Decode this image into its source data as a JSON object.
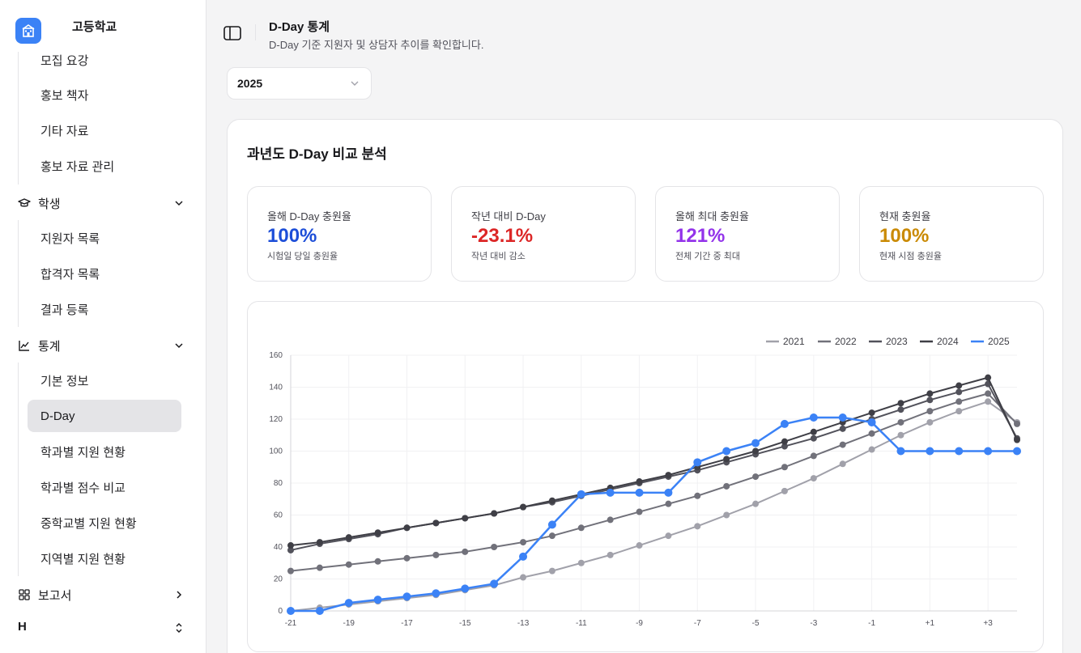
{
  "sidebar": {
    "school_name": "고등학교",
    "partial_item": "모집 요강",
    "promo_items": [
      {
        "label": "홍보 책자"
      },
      {
        "label": "기타 자료"
      },
      {
        "label": "홍보 자료 관리"
      }
    ],
    "groups": {
      "student": {
        "label": "학생",
        "icon": "graduation-cap-icon"
      },
      "stats": {
        "label": "통계",
        "icon": "chart-icon"
      },
      "report": {
        "label": "보고서",
        "icon": "grid-icon"
      },
      "user": {
        "label": "H"
      }
    },
    "student_items": [
      {
        "label": "지원자 목록"
      },
      {
        "label": "합격자 목록"
      },
      {
        "label": "결과 등록"
      }
    ],
    "stats_items": [
      {
        "label": "기본 정보",
        "active": false
      },
      {
        "label": "D-Day",
        "active": true
      },
      {
        "label": "학과별 지원 현황",
        "active": false
      },
      {
        "label": "학과별 점수 비교",
        "active": false
      },
      {
        "label": "중학교별 지원 현황",
        "active": false
      },
      {
        "label": "지역별 지원 현황",
        "active": false
      }
    ]
  },
  "header": {
    "title": "D-Day 통계",
    "subtitle": "D-Day 기준 지원자 및 상담자 추이를 확인합니다."
  },
  "year_select": {
    "value": "2025"
  },
  "card": {
    "title": "과년도 D-Day 비교 분석",
    "stats": [
      {
        "label": "올해 D-Day 충원율",
        "value": "100%",
        "desc": "시험일 당일 충원율",
        "color": "#1d4ed8"
      },
      {
        "label": "작년 대비 D-Day",
        "value": "-23.1%",
        "desc": "작년 대비 감소",
        "color": "#dc2626"
      },
      {
        "label": "올해 최대 충원율",
        "value": "121%",
        "desc": "전체 기간 중 최대",
        "color": "#9333ea"
      },
      {
        "label": "현재 충원율",
        "value": "100%",
        "desc": "현재 시점 충원율",
        "color": "#ca8a04"
      }
    ]
  },
  "chart_data": {
    "type": "line",
    "x": [
      -21,
      -20,
      -19,
      -18,
      -17,
      -16,
      -15,
      -14,
      -13,
      -12,
      -11,
      -10,
      -9,
      -8,
      -7,
      -6,
      -5,
      -4,
      -3,
      -2,
      -1,
      0,
      1,
      2,
      3,
      4
    ],
    "x_tick_labels": [
      "-21",
      "-19",
      "-17",
      "-15",
      "-13",
      "-11",
      "-9",
      "-7",
      "-5",
      "-3",
      "-1",
      "+1",
      "+3"
    ],
    "x_ticks": [
      -21,
      -19,
      -17,
      -15,
      -13,
      -11,
      -9,
      -7,
      -5,
      -3,
      -1,
      1,
      3
    ],
    "y_ticks": [
      0,
      20,
      40,
      60,
      80,
      100,
      120,
      140,
      160
    ],
    "ylim": [
      0,
      160
    ],
    "xlim": [
      -21,
      4
    ],
    "grid": true,
    "legend_position": "top-right",
    "series": [
      {
        "name": "2021",
        "color": "#a1a1aa",
        "values": [
          0,
          2,
          4,
          6,
          8,
          10,
          13,
          16,
          21,
          25,
          30,
          35,
          41,
          47,
          53,
          60,
          67,
          75,
          83,
          92,
          101,
          110,
          118,
          125,
          131,
          118
        ]
      },
      {
        "name": "2022",
        "color": "#71717a",
        "values": [
          25,
          27,
          29,
          31,
          33,
          35,
          37,
          40,
          43,
          47,
          52,
          57,
          62,
          67,
          72,
          78,
          84,
          90,
          97,
          104,
          111,
          118,
          125,
          131,
          136,
          117
        ]
      },
      {
        "name": "2023",
        "color": "#52525b",
        "values": [
          38,
          42,
          45,
          48,
          52,
          55,
          58,
          61,
          65,
          68,
          72,
          76,
          80,
          84,
          88,
          93,
          98,
          103,
          108,
          114,
          120,
          126,
          132,
          137,
          142,
          108
        ]
      },
      {
        "name": "2024",
        "color": "#3f3f46",
        "values": [
          41,
          43,
          46,
          49,
          52,
          55,
          58,
          61,
          65,
          69,
          73,
          77,
          81,
          85,
          90,
          95,
          100,
          106,
          112,
          118,
          124,
          130,
          136,
          141,
          146,
          107
        ]
      },
      {
        "name": "2025",
        "color": "#3b82f6",
        "values": [
          0,
          0,
          5,
          7,
          9,
          11,
          14,
          17,
          34,
          54,
          73,
          74,
          74,
          74,
          93,
          100,
          105,
          117,
          121,
          121,
          118,
          100,
          100,
          100,
          100,
          100
        ]
      }
    ]
  }
}
